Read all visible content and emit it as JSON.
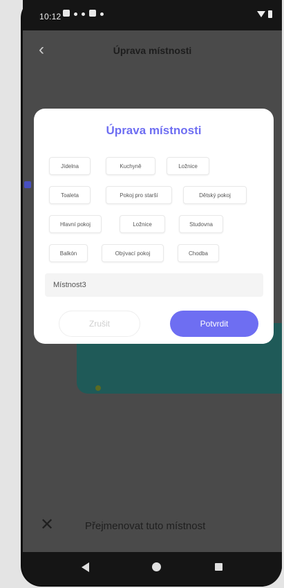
{
  "status_bar": {
    "time": "10:12"
  },
  "header": {
    "title": "Úprava místnosti"
  },
  "dialog": {
    "title": "Úprava místnosti",
    "rooms": [
      "Jídelna",
      "Kuchyně",
      "Ložnice",
      "Toaleta",
      "Pokoj pro starší",
      "Dětský pokoj",
      "Hlavní pokoj",
      "Ložnice",
      "Studovna",
      "Balkón",
      "Obývací pokoj",
      "Chodba"
    ],
    "name_value": "Místnost3",
    "cancel_label": "Zrušit",
    "confirm_label": "Potvrdit"
  },
  "bottom_bar": {
    "text": "Přejmenovat tuto místnost"
  },
  "colors": {
    "accent": "#6e6ef2",
    "map_floor": "#1f5a58",
    "overlay": "#4a4a4a"
  }
}
